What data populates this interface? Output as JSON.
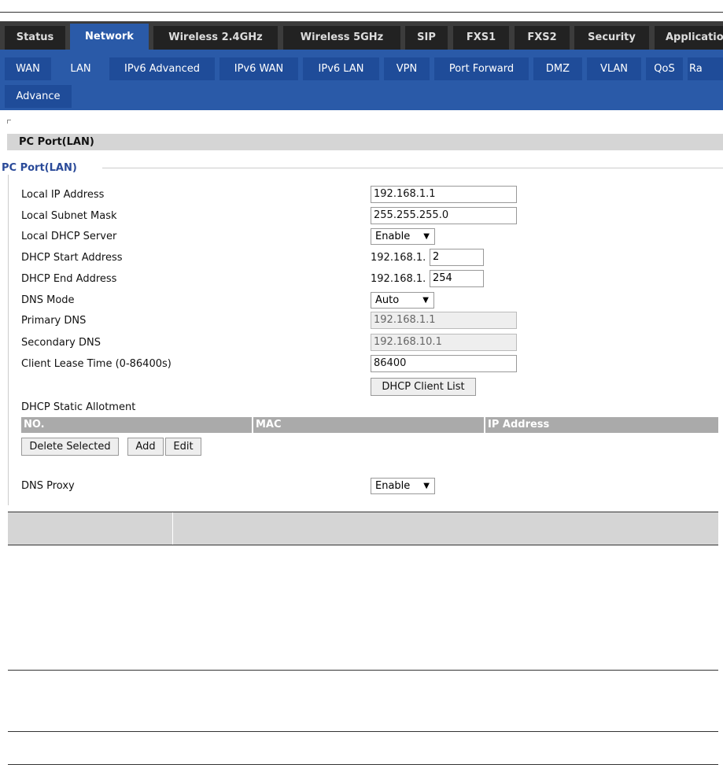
{
  "main_tabs": [
    "Status",
    "Network",
    "Wireless 2.4GHz",
    "Wireless 5GHz",
    "SIP",
    "FXS1",
    "FXS2",
    "Security",
    "Applicatio"
  ],
  "main_active": "Network",
  "sub_tabs": [
    "WAN",
    "LAN",
    "IPv6 Advanced",
    "IPv6 WAN",
    "IPv6 LAN",
    "VPN",
    "Port Forward",
    "DMZ",
    "VLAN",
    "QoS",
    "Ra",
    "Advance"
  ],
  "sub_active": "LAN",
  "section": {
    "header": "PC Port(LAN)",
    "legend": "PC Port(LAN)"
  },
  "form": {
    "local_ip_label": "Local IP Address",
    "local_ip": "192.168.1.1",
    "subnet_label": "Local Subnet Mask",
    "subnet": "255.255.255.0",
    "dhcp_server_label": "Local DHCP Server",
    "dhcp_server": "Enable",
    "dhcp_start_label": "DHCP Start Address",
    "dhcp_start_prefix": "192.168.1.",
    "dhcp_start": "2",
    "dhcp_end_label": "DHCP End Address",
    "dhcp_end_prefix": "192.168.1.",
    "dhcp_end": "254",
    "dns_mode_label": "DNS Mode",
    "dns_mode": "Auto",
    "primary_dns_label": "Primary DNS",
    "primary_dns": "192.168.1.1",
    "secondary_dns_label": "Secondary DNS",
    "secondary_dns": "192.168.10.1",
    "lease_label": "Client Lease Time (0-86400s)",
    "lease": "86400",
    "client_list_button": "DHCP Client List",
    "static_allotment_label": "DHCP Static Allotment",
    "table_headers": [
      "NO.",
      "MAC",
      "IP Address"
    ],
    "delete_button": "Delete Selected",
    "add_button": "Add",
    "edit_button": "Edit",
    "dns_proxy_label": "DNS Proxy",
    "dns_proxy": "Enable"
  }
}
